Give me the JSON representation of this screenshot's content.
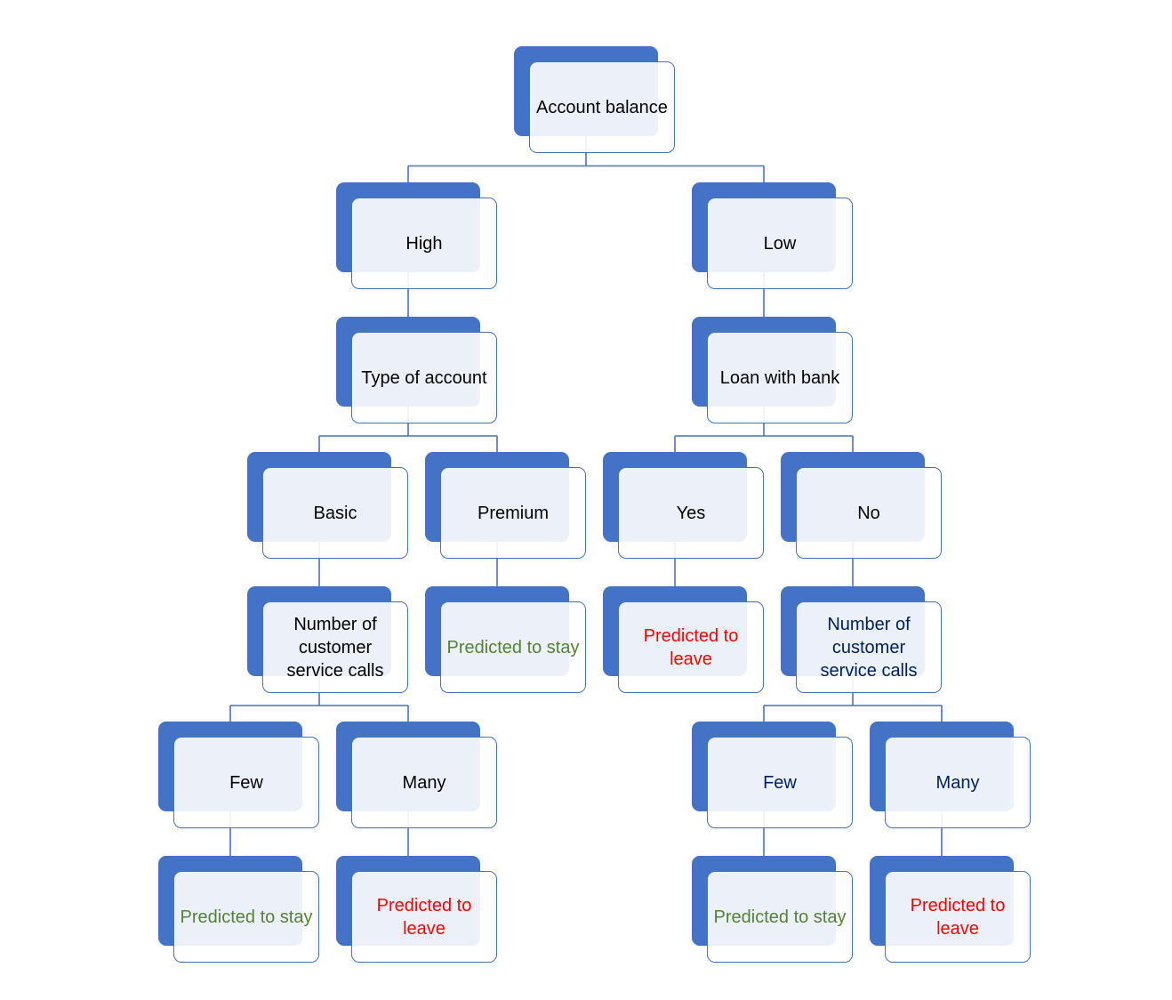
{
  "colors": {
    "box": "#4472C4",
    "default_text": "#000000",
    "stay": "#548235",
    "leave": "#FF0000",
    "navy": "#002060",
    "line": "#4472C4"
  },
  "nodes": [
    {
      "id": "root",
      "label": "Account balance",
      "tone": "default_text",
      "children": [
        "high",
        "low"
      ]
    },
    {
      "id": "high",
      "label": "High",
      "tone": "default_text",
      "children": [
        "type"
      ]
    },
    {
      "id": "low",
      "label": "Low",
      "tone": "default_text",
      "children": [
        "loan"
      ]
    },
    {
      "id": "type",
      "label": "Type of account",
      "tone": "default_text",
      "children": [
        "basic",
        "premium"
      ]
    },
    {
      "id": "loan",
      "label": "Loan with bank",
      "tone": "default_text",
      "children": [
        "yes",
        "no"
      ]
    },
    {
      "id": "basic",
      "label": "Basic",
      "tone": "default_text",
      "children": [
        "calls1"
      ]
    },
    {
      "id": "premium",
      "label": "Premium",
      "tone": "default_text",
      "children": [
        "pstay1"
      ]
    },
    {
      "id": "yes",
      "label": "Yes",
      "tone": "default_text",
      "children": [
        "pleave1"
      ]
    },
    {
      "id": "no",
      "label": "No",
      "tone": "default_text",
      "children": [
        "calls2"
      ]
    },
    {
      "id": "calls1",
      "label": "Number of customer service calls",
      "tone": "default_text",
      "children": [
        "few1",
        "many1"
      ]
    },
    {
      "id": "pstay1",
      "label": "Predicted to stay",
      "tone": "stay",
      "children": []
    },
    {
      "id": "pleave1",
      "label": "Predicted to leave",
      "tone": "leave",
      "children": []
    },
    {
      "id": "calls2",
      "label": "Number of customer service calls",
      "tone": "navy",
      "children": [
        "few2",
        "many2"
      ]
    },
    {
      "id": "few1",
      "label": "Few",
      "tone": "default_text",
      "children": [
        "pstay2"
      ]
    },
    {
      "id": "many1",
      "label": "Many",
      "tone": "default_text",
      "children": [
        "pleave2"
      ]
    },
    {
      "id": "few2",
      "label": "Few",
      "tone": "navy",
      "children": [
        "pstay3"
      ]
    },
    {
      "id": "many2",
      "label": "Many",
      "tone": "navy",
      "children": [
        "pleave3"
      ]
    },
    {
      "id": "pstay2",
      "label": "Predicted to stay",
      "tone": "stay",
      "children": []
    },
    {
      "id": "pleave2",
      "label": "Predicted to leave",
      "tone": "leave",
      "children": []
    },
    {
      "id": "pstay3",
      "label": "Predicted to stay",
      "tone": "stay",
      "children": []
    },
    {
      "id": "pleave3",
      "label": "Predicted to leave",
      "tone": "leave",
      "children": []
    }
  ]
}
